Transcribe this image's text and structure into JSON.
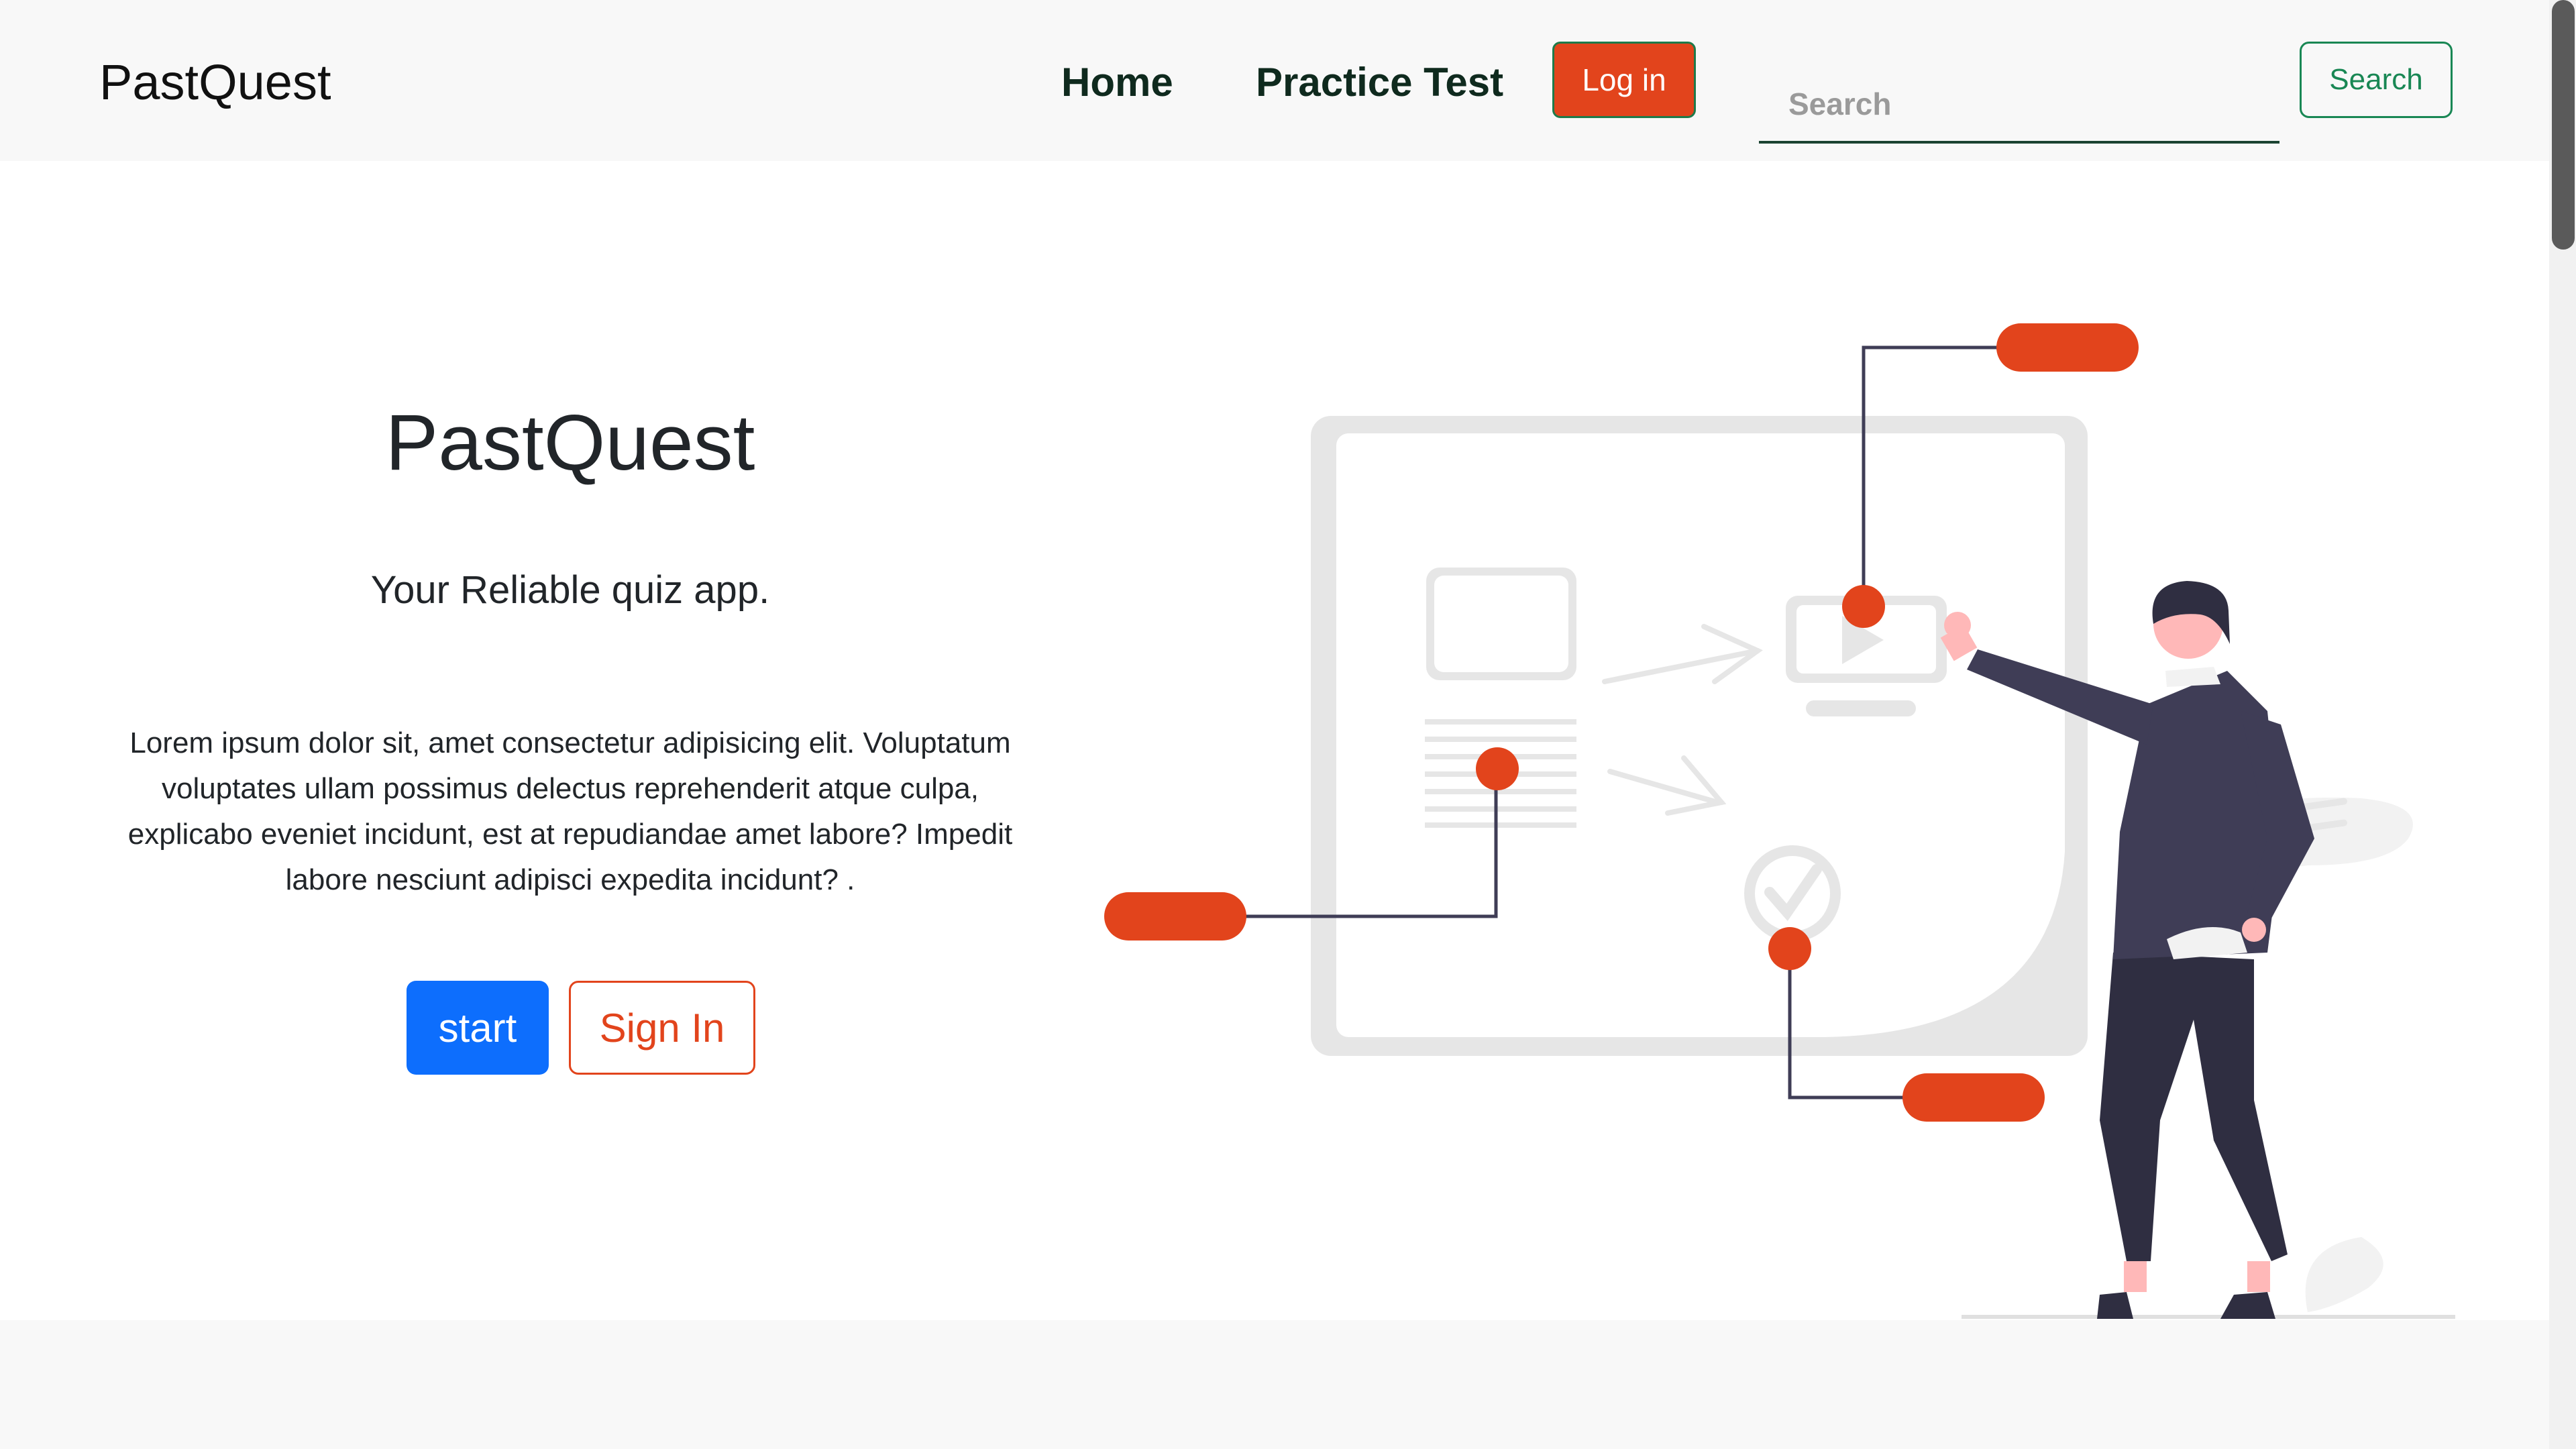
{
  "navbar": {
    "brand": "PastQuest",
    "links": [
      "Home",
      "Practice Test"
    ],
    "login_label": "Log in",
    "search_placeholder": "Search",
    "search_button": "Search"
  },
  "hero": {
    "title": "PastQuest",
    "subtitle": "Your Reliable quiz app.",
    "body": "Lorem ipsum dolor sit, amet consectetur adipisicing elit. Voluptatum voluptates ullam possimus delectus reprehenderit atque culpa, explicabo eveniet incidunt, est at repudiandae amet labore? Impedit labore nesciunt adipisci expedita incidunt? .",
    "start_button": "start",
    "signin_button": "Sign In"
  },
  "colors": {
    "accent": "#e2441c",
    "primary": "#0d6efd",
    "success": "#198754",
    "figure_dark": "#3f3d56"
  },
  "icons": [
    "play-icon",
    "checkmark-icon",
    "document-icon"
  ]
}
